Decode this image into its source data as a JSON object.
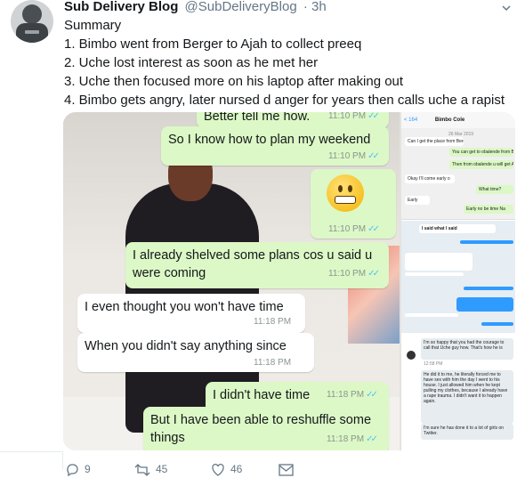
{
  "tweet": {
    "author_name": "Sub Delivery Blog",
    "handle": "@SubDeliveryBlog",
    "time": "· 3h",
    "lines": [
      "Summary",
      "1. Bimbo went from Berger to Ajah to collect preeq",
      "2. Uche lost interest as soon as he met her",
      "3. Uche then focused more on his laptop after making out",
      "4. Bimbo gets angry, later nursed d anger for years then calls uche a rapist"
    ]
  },
  "chat_left": [
    {
      "text": "Better tell me how.",
      "time": "11:10 PM",
      "read": "✓✓"
    },
    {
      "text": "So I know how to plan my weekend",
      "time": "11:10 PM",
      "read": "✓✓"
    },
    {
      "text": "",
      "time": "11:10 PM",
      "read": "✓✓"
    },
    {
      "text": "I already shelved some plans cos u said u were coming",
      "line1": "I already shelved some plans cos u said u",
      "line2": "were coming",
      "time": "11:10 PM",
      "read": "✓✓"
    },
    {
      "text": "I even thought you won't have time",
      "time": "11:18 PM"
    },
    {
      "text": "When you didn't say anything since",
      "time": "11:18 PM"
    },
    {
      "text": "I didn't have time",
      "time": "11:18 PM",
      "read": "✓✓"
    },
    {
      "line1": "But I have been able to reshuffle some",
      "line2": "things",
      "time": "11:18 PM",
      "read": "✓✓"
    }
  ],
  "chat_right": {
    "back": "< 164",
    "contact": "Bimbo Cole",
    "date": "26 Mar 2019",
    "messages": [
      "Can I get the place from Berger?",
      "You can get to obalende from Berger",
      "Then from obalende u will get Ajah",
      "Okay I'll come early o",
      "What time?",
      "Early",
      "Early no be time Na"
    ],
    "dm_header": "I said what I said",
    "dm_messages": [
      "I'm so happy that you had the courage to call that Uche guy how. That's how he is",
      "He did it to me, he literally forced me to have sex with him the day I went to his house. I just allowed him when he kept pulling my clothes, because I already have a rape trauma. I didn't want it to happen again.",
      "I'm sure he has done it to a lot of girls on Twitter."
    ],
    "dm_time": "12:58 PM"
  },
  "actions": {
    "reply_count": "9",
    "retweet_count": "45",
    "like_count": "46"
  },
  "colors": {
    "outgoing": "#dcf8c6",
    "incoming": "#ffffff",
    "read_tick": "#4fc3f7"
  }
}
